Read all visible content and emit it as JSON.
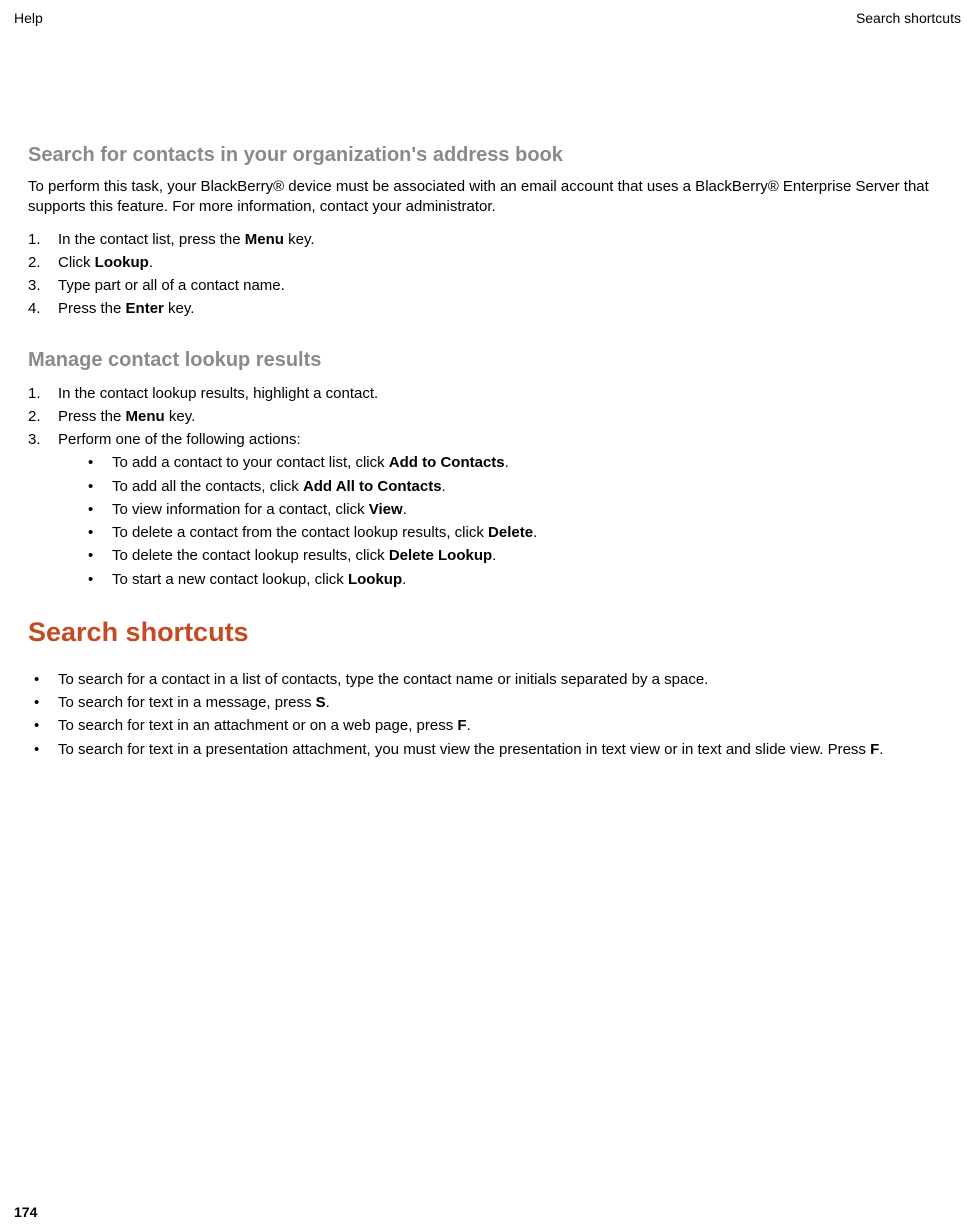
{
  "header": {
    "left": "Help",
    "right": "Search shortcuts"
  },
  "s1": {
    "title": "Search for contacts in your organization's address book",
    "intro": "To perform this task, your BlackBerry® device must be associated with an email account that uses a BlackBerry® Enterprise Server that supports this feature. For more information, contact your administrator.",
    "step1_a": "In the contact list, press the ",
    "step1_b": "Menu",
    "step1_c": " key.",
    "step2_a": "Click ",
    "step2_b": "Lookup",
    "step2_c": ".",
    "step3": "Type part or all of a contact name.",
    "step4_a": "Press the ",
    "step4_b": "Enter",
    "step4_c": " key."
  },
  "s2": {
    "title": "Manage contact lookup results",
    "step1": "In the contact lookup results, highlight a contact.",
    "step2_a": "Press the ",
    "step2_b": "Menu",
    "step2_c": " key.",
    "step3": "Perform one of the following actions:",
    "b1_a": "To add a contact to your contact list, click ",
    "b1_b": "Add to Contacts",
    "b1_c": ".",
    "b2_a": "To add all the contacts, click ",
    "b2_b": "Add All to Contacts",
    "b2_c": ".",
    "b3_a": "To view information for a contact, click ",
    "b3_b": "View",
    "b3_c": ".",
    "b4_a": "To delete a contact from the contact lookup results, click ",
    "b4_b": "Delete",
    "b4_c": ".",
    "b5_a": "To delete the contact lookup results, click ",
    "b5_b": "Delete Lookup",
    "b5_c": ".",
    "b6_a": "To start a new contact lookup, click ",
    "b6_b": "Lookup",
    "b6_c": "."
  },
  "s3": {
    "title": "Search shortcuts",
    "b1": "To search for a contact in a list of contacts, type the contact name or initials separated by a space.",
    "b2_a": "To search for text in a message, press ",
    "b2_b": "S",
    "b2_c": ".",
    "b3_a": "To search for text in an attachment or on a web page, press ",
    "b3_b": "F",
    "b3_c": ".",
    "b4_a": "To search for text in a presentation attachment, you must view the presentation in text view or in text and slide view. Press ",
    "b4_b": "F",
    "b4_c": "."
  },
  "footer": {
    "page": "174"
  }
}
